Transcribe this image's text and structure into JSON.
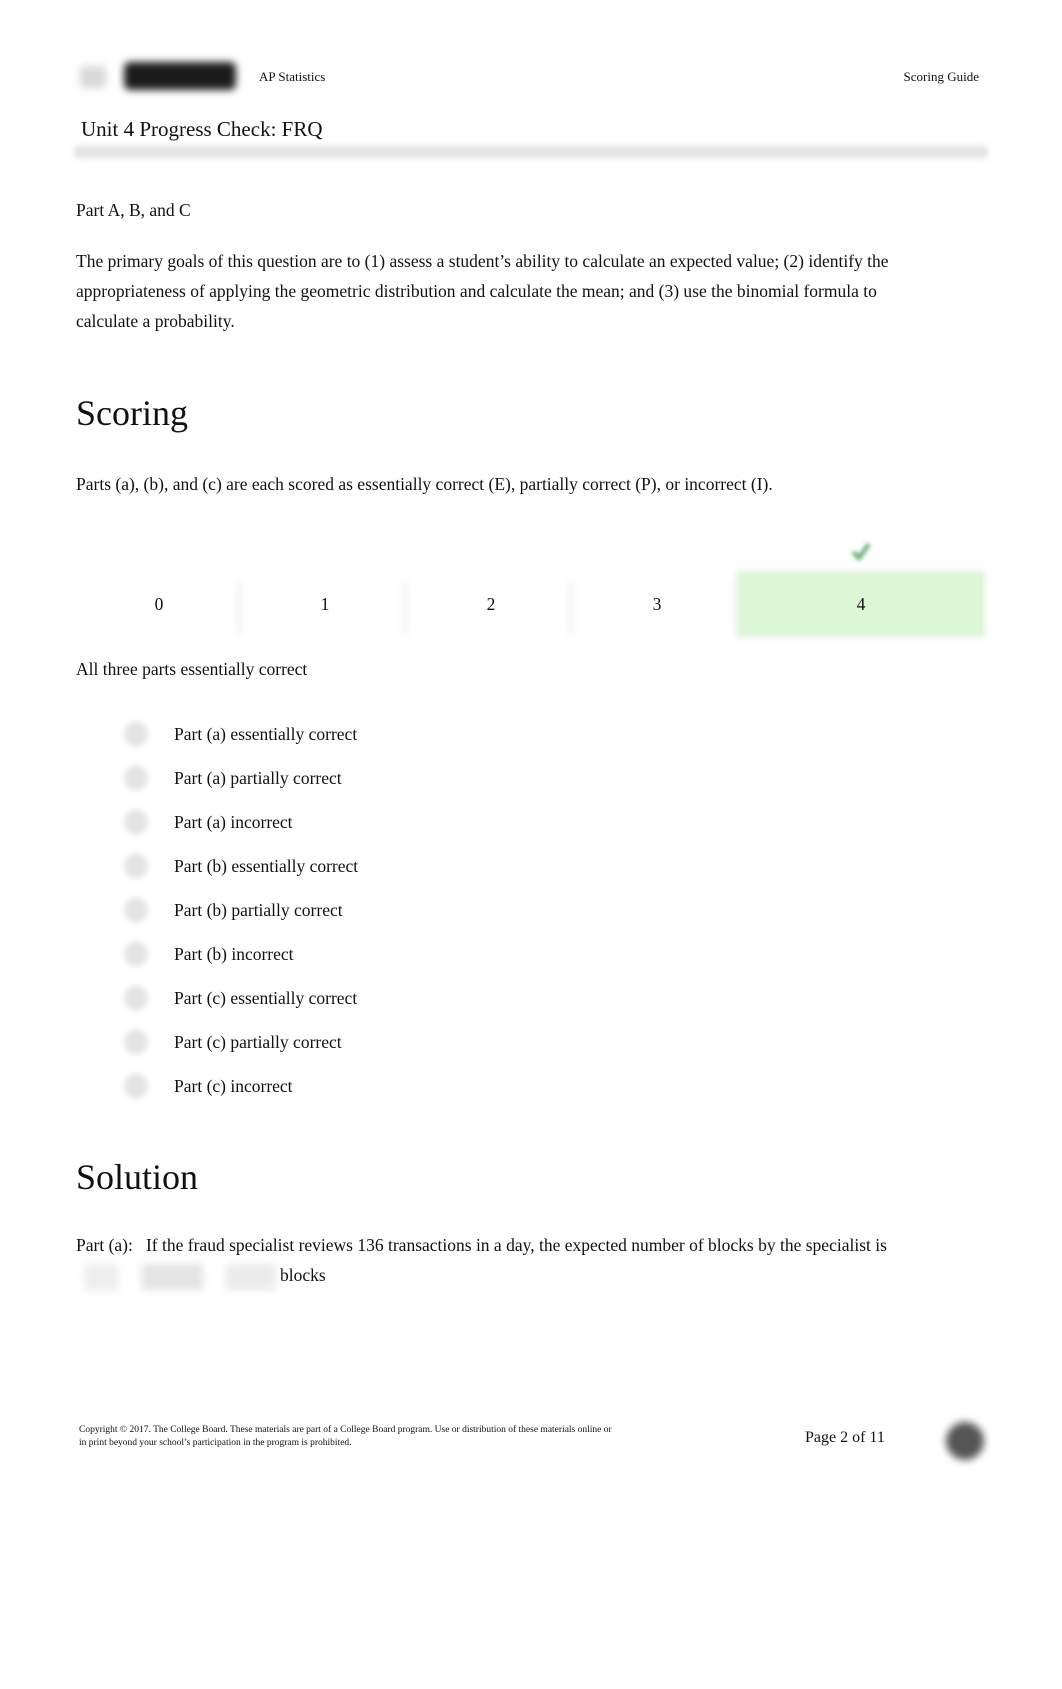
{
  "header": {
    "logo_icon": "college-board-logo",
    "course": "AP Statistics",
    "document_type": "Scoring Guide",
    "title": "Unit 4 Progress Check: FRQ"
  },
  "intro": {
    "part_heading": "Part A, B, and C",
    "goals": "The primary goals of this question are to (1) assess a student’s ability to calculate an expected value; (2) identify the appropriateness of applying the geometric distribution and calculate the mean; and (3) use the binomial formula to calculate a probability."
  },
  "scoring": {
    "heading": "Scoring",
    "description": "Parts (a), (b), and (c) are each scored as essentially correct (E), partially correct (P), or incorrect (I).",
    "scores": [
      "0",
      "1",
      "2",
      "3",
      "4"
    ],
    "selected_score": "4",
    "selected_color": "#dcf7d6",
    "selected_label": "All three parts essentially correct",
    "criteria": [
      "Part (a) essentially correct",
      "Part (a) partially correct",
      "Part (a) incorrect",
      "Part (b) essentially correct",
      "Part (b) partially correct",
      "Part (b) incorrect",
      "Part (c) essentially correct",
      "Part (c) partially correct",
      "Part (c) incorrect"
    ]
  },
  "solution": {
    "heading": "Solution",
    "part_a_label": "Part (a):",
    "part_a_text": "If the fraud specialist reviews 136 transactions in a day, the expected number of blocks by the specialist is",
    "part_a_suffix": "blocks"
  },
  "footer": {
    "copyright": "Copyright © 2017. The College Board. These materials are part of a College Board program. Use or distribution of these materials online or in print beyond your school’s participation in the program is prohibited.",
    "page": "Page 2 of 11"
  }
}
